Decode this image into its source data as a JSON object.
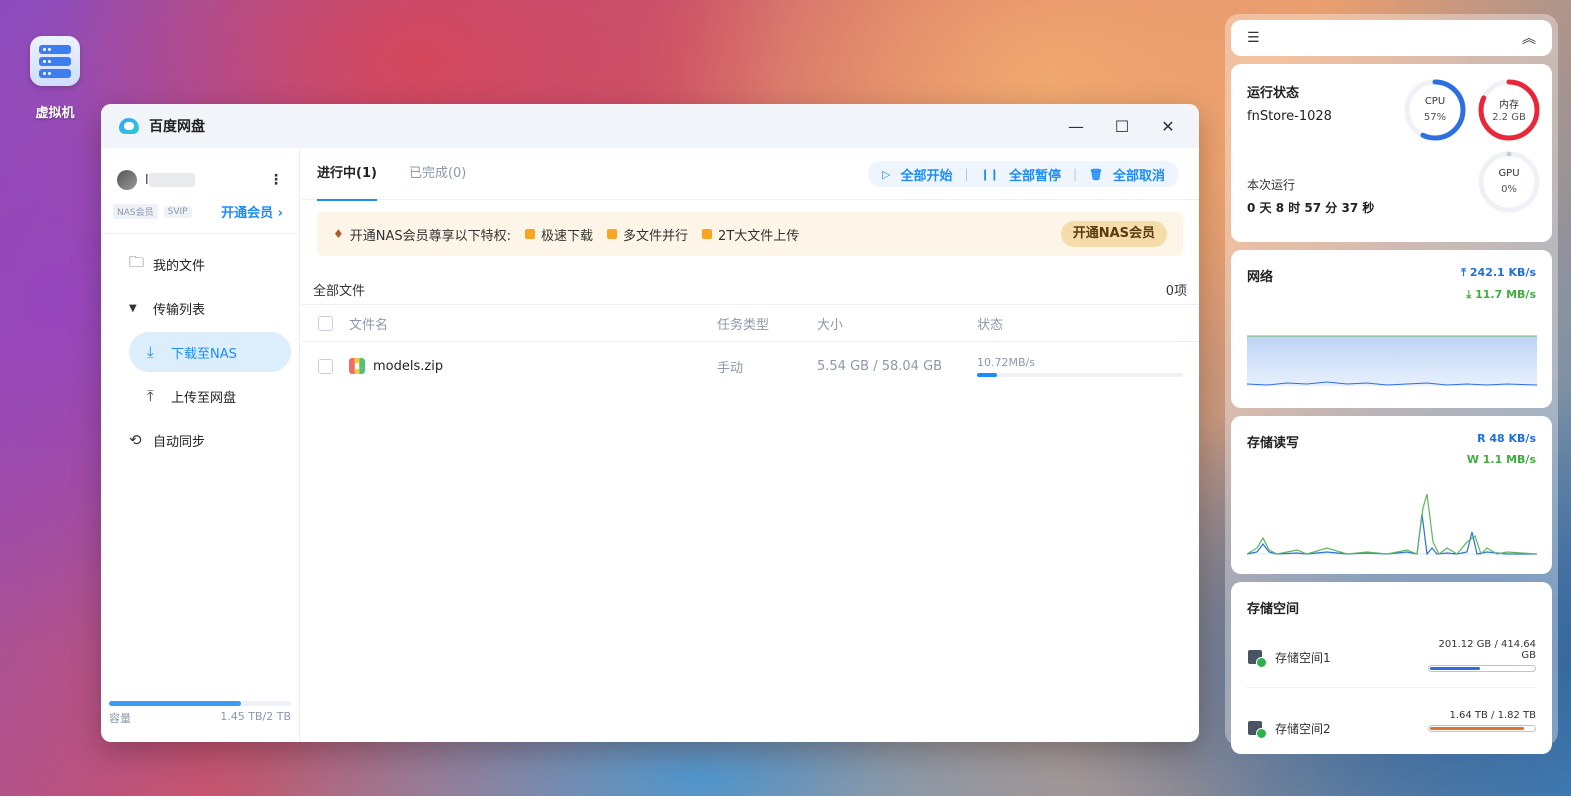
{
  "desktop": {
    "vm_label": "虚拟机"
  },
  "window": {
    "title": "百度网盘",
    "minimize": "—",
    "maximize": "☐",
    "close": "✕"
  },
  "sidebar": {
    "username_prefix": "l",
    "more": "⋮",
    "badges": [
      "NAS会员",
      "SVIP"
    ],
    "vip_link": "开通会员 ›",
    "items": [
      {
        "label": "我的文件",
        "icon": "folder-icon"
      },
      {
        "label": "传输列表",
        "icon": "caret-down-icon"
      },
      {
        "label": "下载至NAS",
        "icon": "download-icon"
      },
      {
        "label": "上传至网盘",
        "icon": "upload-icon"
      },
      {
        "label": "自动同步",
        "icon": "sync-icon"
      }
    ],
    "capacity_label": "容量",
    "capacity_value": "1.45 TB/2 TB",
    "capacity_fraction": 0.725
  },
  "tabs": [
    {
      "label": "进行中(1)"
    },
    {
      "label": "已完成(0)"
    }
  ],
  "actions": {
    "start_all": "全部开始",
    "pause_all": "全部暂停",
    "cancel_all": "全部取消"
  },
  "promo": {
    "text": "开通NAS会员尊享以下特权:",
    "features": [
      "极速下载",
      "多文件并行",
      "2T大文件上传"
    ],
    "button": "开通NAS会员"
  },
  "files": {
    "crumb": "全部文件",
    "count": "0项",
    "columns": {
      "name": "文件名",
      "type": "任务类型",
      "size": "大小",
      "status": "状态"
    },
    "rows": [
      {
        "name": "models.zip",
        "type": "手动",
        "size": "5.54 GB / 58.04 GB",
        "speed": "10.72MB/s",
        "progress": 0.095
      }
    ]
  },
  "widgets": {
    "status": {
      "title": "运行状态",
      "host": "fnStore-1028",
      "cpu": {
        "label": "CPU",
        "value": "57%",
        "fraction": 0.57,
        "color": "#2d6fe0"
      },
      "mem": {
        "label": "内存",
        "value": "2.2 GB",
        "fraction": 0.82,
        "color": "#e8283a"
      },
      "gpu": {
        "label": "GPU",
        "value": "0%",
        "fraction": 0.0,
        "color": "#cccccc"
      },
      "uptime_label": "本次运行",
      "uptime": "0 天 8 时 57 分 37 秒"
    },
    "network": {
      "title": "网络",
      "up": "242.1 KB/s",
      "down": "11.7 MB/s"
    },
    "io": {
      "title": "存储读写",
      "read": "R  48 KB/s",
      "write": "W  1.1 MB/s"
    },
    "space": {
      "title": "存储空间",
      "volumes": [
        {
          "name": "存储空间1",
          "info": "201.12 GB / 414.64 GB",
          "fraction": 0.485,
          "color": "#2d6fe0"
        },
        {
          "name": "存储空间2",
          "info": "1.64 TB / 1.82 TB",
          "fraction": 0.9,
          "color": "#e0712a"
        }
      ]
    }
  }
}
